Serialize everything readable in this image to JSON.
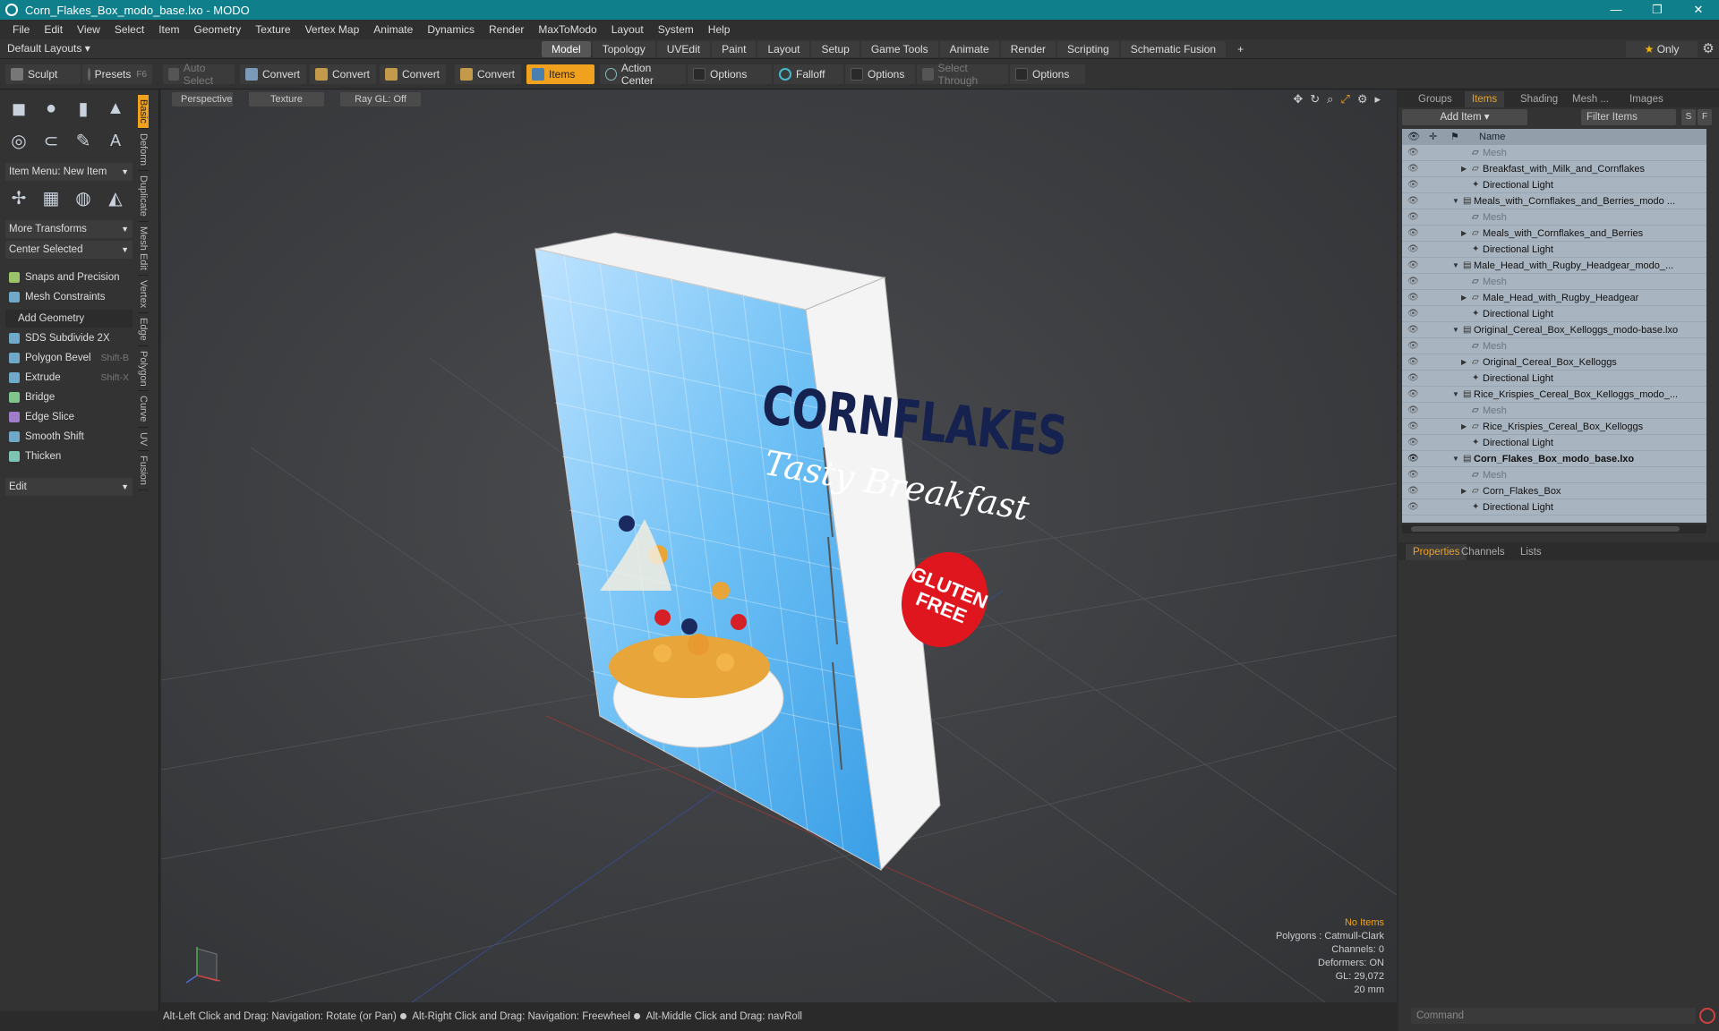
{
  "window": {
    "title": "Corn_Flakes_Box_modo_base.lxo - MODO",
    "min": "—",
    "max": "❐",
    "close": "✕"
  },
  "menu": [
    "File",
    "Edit",
    "View",
    "Select",
    "Item",
    "Geometry",
    "Texture",
    "Vertex Map",
    "Animate",
    "Dynamics",
    "Render",
    "MaxToModo",
    "Layout",
    "System",
    "Help"
  ],
  "layoutbar": {
    "default_layouts": "Default Layouts ▾",
    "tabs": [
      "Model",
      "Topology",
      "UVEdit",
      "Paint",
      "Layout",
      "Setup",
      "Game Tools",
      "Animate",
      "Render",
      "Scripting",
      "Schematic Fusion"
    ],
    "active_tab": "Model",
    "plus": "+",
    "only": "Only"
  },
  "toolbar": {
    "sculpt": "Sculpt",
    "presets": "Presets",
    "presets_key": "F6",
    "auto_select": "Auto Select",
    "convert": "Convert",
    "items": "Items",
    "action_center": "Action Center",
    "options": "Options",
    "falloff": "Falloff",
    "select_through": "Select Through"
  },
  "left": {
    "item_menu": "Item Menu: New Item",
    "more_transforms": "More Transforms",
    "center_selected": "Center Selected",
    "snaps": "Snaps and Precision",
    "mesh_constraints": "Mesh Constraints",
    "add_geometry": "Add Geometry",
    "tools": [
      {
        "label": "SDS Subdivide 2X",
        "shortcut": ""
      },
      {
        "label": "Polygon Bevel",
        "shortcut": "Shift-B"
      },
      {
        "label": "Extrude",
        "shortcut": "Shift-X"
      },
      {
        "label": "Bridge",
        "shortcut": ""
      },
      {
        "label": "Edge Slice",
        "shortcut": ""
      },
      {
        "label": "Smooth Shift",
        "shortcut": ""
      },
      {
        "label": "Thicken",
        "shortcut": ""
      }
    ],
    "edit": "Edit",
    "side_tabs": [
      "Basic",
      "Deform",
      "Duplicate",
      "Mesh Edit",
      "Vertex",
      "Edge",
      "Polygon",
      "Curve",
      "UV",
      "Fusion"
    ]
  },
  "viewport": {
    "perspective": "Perspective",
    "texture": "Texture",
    "raygl": "Ray GL: Off",
    "box_brand": "CORNFLAKES",
    "box_tagline": "Tasty Breakfast",
    "box_badge": "GLUTEN FREE",
    "info": {
      "no_items": "No Items",
      "polygons": "Polygons : Catmull-Clark",
      "channels": "Channels: 0",
      "deformers": "Deformers: ON",
      "gl": "GL: 29,072",
      "size": "20 mm"
    }
  },
  "status": {
    "rotate": "Alt-Left Click and Drag: Navigation: Rotate (or Pan)",
    "freewheel": "Alt-Right Click and Drag: Navigation: Freewheel",
    "navroll": "Alt-Middle Click and Drag: navRoll"
  },
  "right": {
    "tabs": [
      "Groups",
      "Items",
      "Shading",
      "Mesh ...",
      "Images"
    ],
    "active_tab": "Items",
    "add_item": "Add Item",
    "filter_placeholder": "Filter Items",
    "s": "S",
    "f": "F",
    "name_col": "Name",
    "rows": [
      {
        "name": "Mesh",
        "level": 2,
        "kind": "mesh",
        "dim": true
      },
      {
        "name": "Breakfast_with_Milk_and_Cornflakes",
        "level": 2,
        "kind": "group"
      },
      {
        "name": "Directional Light",
        "level": 2,
        "kind": "light"
      },
      {
        "name": "Meals_with_Cornflakes_and_Berries_modo ...",
        "level": 1,
        "kind": "scene"
      },
      {
        "name": "Mesh",
        "level": 2,
        "kind": "mesh",
        "dim": true
      },
      {
        "name": "Meals_with_Cornflakes_and_Berries",
        "level": 2,
        "kind": "group"
      },
      {
        "name": "Directional Light",
        "level": 2,
        "kind": "light"
      },
      {
        "name": "Male_Head_with_Rugby_Headgear_modo_...",
        "level": 1,
        "kind": "scene"
      },
      {
        "name": "Mesh",
        "level": 2,
        "kind": "mesh",
        "dim": true
      },
      {
        "name": "Male_Head_with_Rugby_Headgear",
        "level": 2,
        "kind": "group"
      },
      {
        "name": "Directional Light",
        "level": 2,
        "kind": "light"
      },
      {
        "name": "Original_Cereal_Box_Kelloggs_modo-base.lxo",
        "level": 1,
        "kind": "scene"
      },
      {
        "name": "Mesh",
        "level": 2,
        "kind": "mesh",
        "dim": true
      },
      {
        "name": "Original_Cereal_Box_Kelloggs",
        "level": 2,
        "kind": "group"
      },
      {
        "name": "Directional Light",
        "level": 2,
        "kind": "light"
      },
      {
        "name": "Rice_Krispies_Cereal_Box_Kelloggs_modo_...",
        "level": 1,
        "kind": "scene"
      },
      {
        "name": "Mesh",
        "level": 2,
        "kind": "mesh",
        "dim": true
      },
      {
        "name": "Rice_Krispies_Cereal_Box_Kelloggs",
        "level": 2,
        "kind": "group"
      },
      {
        "name": "Directional Light",
        "level": 2,
        "kind": "light"
      },
      {
        "name": "Corn_Flakes_Box_modo_base.lxo",
        "level": 1,
        "kind": "scene",
        "bold": true
      },
      {
        "name": "Mesh",
        "level": 2,
        "kind": "mesh",
        "dim": true
      },
      {
        "name": "Corn_Flakes_Box",
        "level": 2,
        "kind": "group"
      },
      {
        "name": "Directional Light",
        "level": 2,
        "kind": "light"
      }
    ],
    "prop_tabs": [
      "Properties",
      "Channels",
      "Lists"
    ],
    "command_placeholder": "Command"
  }
}
